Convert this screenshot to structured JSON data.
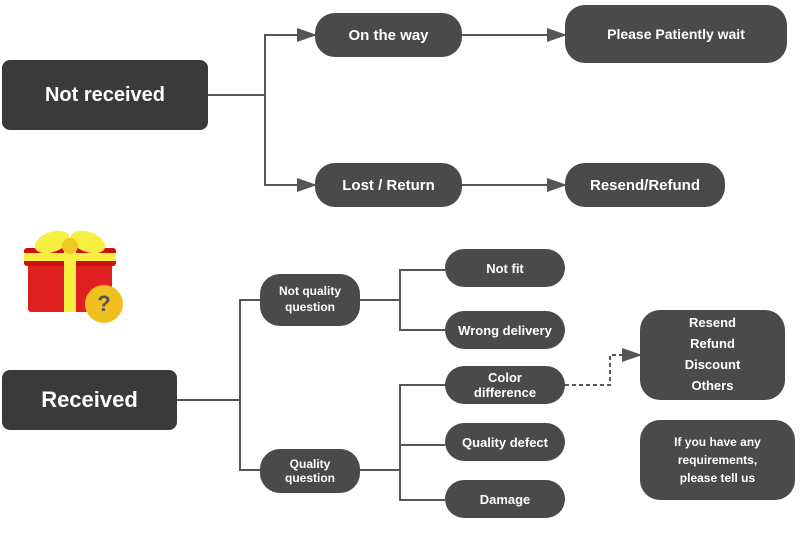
{
  "nodes": {
    "not_received": "Not received",
    "received": "Received",
    "on_the_way": "On the way",
    "please_wait": "Please Patiently wait",
    "lost_return": "Lost / Return",
    "resend_refund_1": "Resend/Refund",
    "not_quality_question": "Not quality\nquestion",
    "quality_question": "Quality question",
    "not_fit": "Not fit",
    "wrong_delivery": "Wrong delivery",
    "color_difference": "Color difference",
    "quality_defect": "Quality defect",
    "damage": "Damage",
    "resend_options": "Resend\nRefund\nDiscount\nOthers",
    "if_requirements": "If you have any\nrequirements,\nplease tell us"
  }
}
